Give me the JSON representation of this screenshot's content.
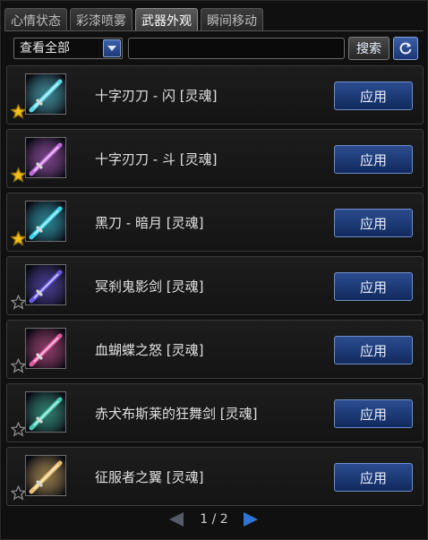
{
  "tabs": [
    {
      "label": "心情状态",
      "active": false
    },
    {
      "label": "彩漆喷雾",
      "active": false
    },
    {
      "label": "武器外观",
      "active": true
    },
    {
      "label": "瞬间移动",
      "active": false
    }
  ],
  "toolbar": {
    "filter_value": "查看全部",
    "search_value": "",
    "search_label": "搜索",
    "refresh_icon": "refresh-icon"
  },
  "items": [
    {
      "name": "十字刃刀 - 闪 [灵魂]",
      "favorite": true,
      "apply_label": "应用",
      "icon": "weapon-blade-icon",
      "accent": "#5fd6e8"
    },
    {
      "name": "十字刃刀 - 斗 [灵魂]",
      "favorite": true,
      "apply_label": "应用",
      "icon": "weapon-blade-icon",
      "accent": "#c06ad8"
    },
    {
      "name": "黑刀 - 暗月 [灵魂]",
      "favorite": true,
      "apply_label": "应用",
      "icon": "weapon-katana-icon",
      "accent": "#3fd0e8"
    },
    {
      "name": "冥刹鬼影剑 [灵魂]",
      "favorite": false,
      "apply_label": "应用",
      "icon": "weapon-ghost-sword-icon",
      "accent": "#6a5ae0"
    },
    {
      "name": "血蝴蝶之怒 [灵魂]",
      "favorite": false,
      "apply_label": "应用",
      "icon": "weapon-butterfly-icon",
      "accent": "#e05aa0"
    },
    {
      "name": "赤犬布斯莱的狂舞剑 [灵魂]",
      "favorite": false,
      "apply_label": "应用",
      "icon": "weapon-sword-icon",
      "accent": "#48c8b0"
    },
    {
      "name": "征服者之翼 [灵魂]",
      "favorite": false,
      "apply_label": "应用",
      "icon": "weapon-wing-icon",
      "accent": "#e8c070"
    }
  ],
  "pagination": {
    "text": "1 / 2",
    "current": 1,
    "total": 2
  }
}
